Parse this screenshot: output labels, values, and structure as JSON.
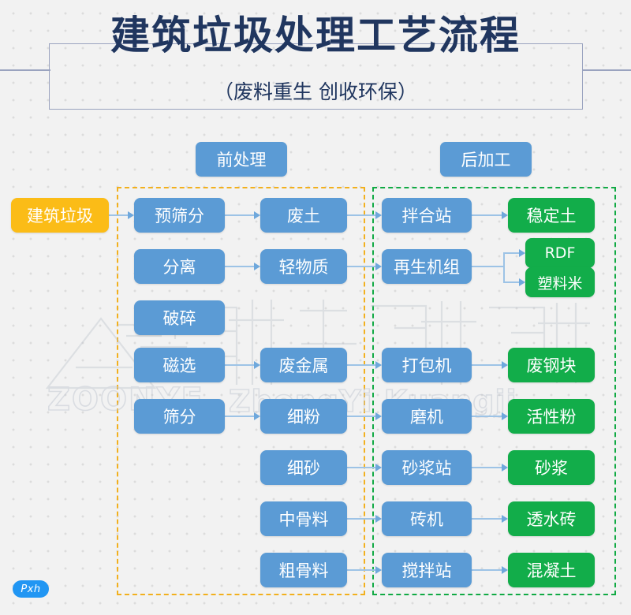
{
  "header": {
    "title": "建筑垃圾处理工艺流程",
    "subtitle": "（废料重生  创收环保）"
  },
  "zones": {
    "pre": {
      "label": "前处理",
      "border_color": "#f2b01e"
    },
    "post": {
      "label": "后加工",
      "border_color": "#11aa44"
    }
  },
  "colors": {
    "blue": "#5b9bd5",
    "green": "#12ad4a",
    "amber": "#fbbc17",
    "connector": "#9dc3e6",
    "title": "#20365f"
  },
  "source": {
    "label": "建筑垃圾"
  },
  "nodes": {
    "c1": [
      {
        "label": "预筛分"
      },
      {
        "label": "分离"
      },
      {
        "label": "破碎"
      },
      {
        "label": "磁选"
      },
      {
        "label": "筛分"
      }
    ],
    "c2": [
      {
        "label": "废土"
      },
      {
        "label": "轻物质"
      },
      {
        "label": "废金属"
      },
      {
        "label": "细粉"
      },
      {
        "label": "细砂"
      },
      {
        "label": "中骨料"
      },
      {
        "label": "粗骨料"
      }
    ],
    "c3": [
      {
        "label": "拌合站"
      },
      {
        "label": "再生机组"
      },
      {
        "label": "打包机"
      },
      {
        "label": "磨机"
      },
      {
        "label": "砂浆站"
      },
      {
        "label": "砖机"
      },
      {
        "label": "搅拌站"
      }
    ],
    "c4": [
      {
        "label": "稳定土"
      },
      {
        "label": "RDF"
      },
      {
        "label": "塑料米"
      },
      {
        "label": "废钢块"
      },
      {
        "label": "活性粉"
      },
      {
        "label": "砂浆"
      },
      {
        "label": "透水砖"
      },
      {
        "label": "混凝土"
      }
    ]
  },
  "watermark": {
    "cn": "中意矿机",
    "en_primary": "ZOONYE",
    "en_secondary": "ZhongYi Kuangji"
  },
  "badge": {
    "label": "Pxh"
  }
}
